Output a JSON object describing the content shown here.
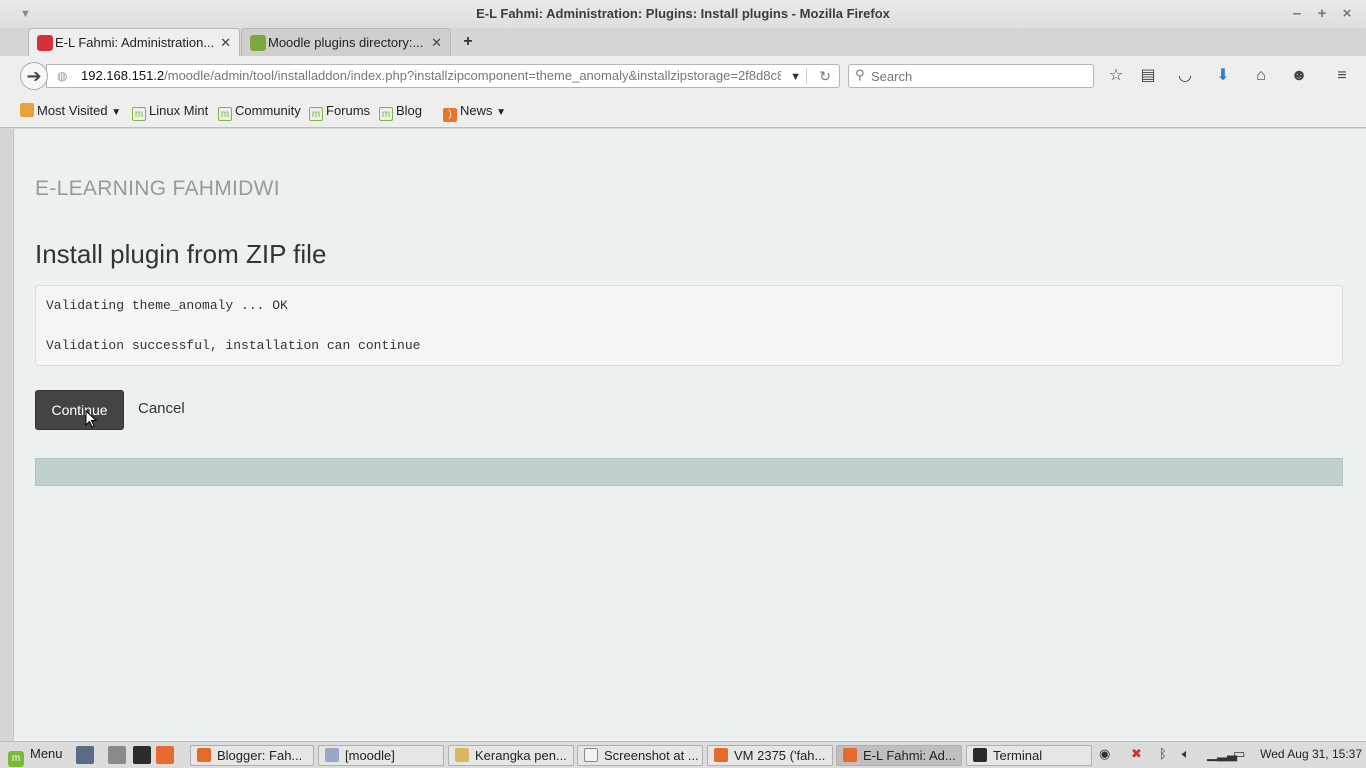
{
  "window": {
    "title": "E-L Fahmi: Administration: Plugins: Install plugins - Mozilla Firefox",
    "controls": {
      "minimize": "–",
      "maximize": "+",
      "close": "×"
    }
  },
  "tabs": [
    {
      "label": "E-L Fahmi: Administration...",
      "active": true
    },
    {
      "label": "Moodle plugins directory:...",
      "active": false
    }
  ],
  "navbar": {
    "url_host": "192.168.151.2",
    "url_path": "/moodle/admin/tool/installaddon/index.php?installzipcomponent=theme_anomaly&installzipstorage=2f8d8c8e-2",
    "search_placeholder": "Search"
  },
  "bookmarks": [
    {
      "label": "Most Visited",
      "dropdown": true
    },
    {
      "label": "Linux Mint"
    },
    {
      "label": "Community"
    },
    {
      "label": "Forums"
    },
    {
      "label": "Blog"
    },
    {
      "label": "News",
      "dropdown": true
    }
  ],
  "page": {
    "site_name": "E-LEARNING FAHMIDWI",
    "title": "Install plugin from ZIP file",
    "output_line1": "Validating theme_anomaly ... OK",
    "output_line2": "Validation successful, installation can continue",
    "continue_label": "Continue",
    "cancel_label": "Cancel"
  },
  "taskbar": {
    "menu_label": "Menu",
    "tasks": [
      {
        "label": "Blogger: Fah..."
      },
      {
        "label": "[moodle]"
      },
      {
        "label": "Kerangka pen..."
      },
      {
        "label": "Screenshot at ..."
      },
      {
        "label": "VM 2375 ('fah..."
      },
      {
        "label": "E-L Fahmi: Ad...",
        "active": true
      },
      {
        "label": "Terminal"
      }
    ],
    "clock": "Wed Aug 31, 15:37"
  },
  "colors": {
    "content_bg": "#ecf0f1",
    "button_dark": "#444444",
    "footer_bar": "#c1cfd0",
    "download_arrow": "#2a7fd4"
  }
}
